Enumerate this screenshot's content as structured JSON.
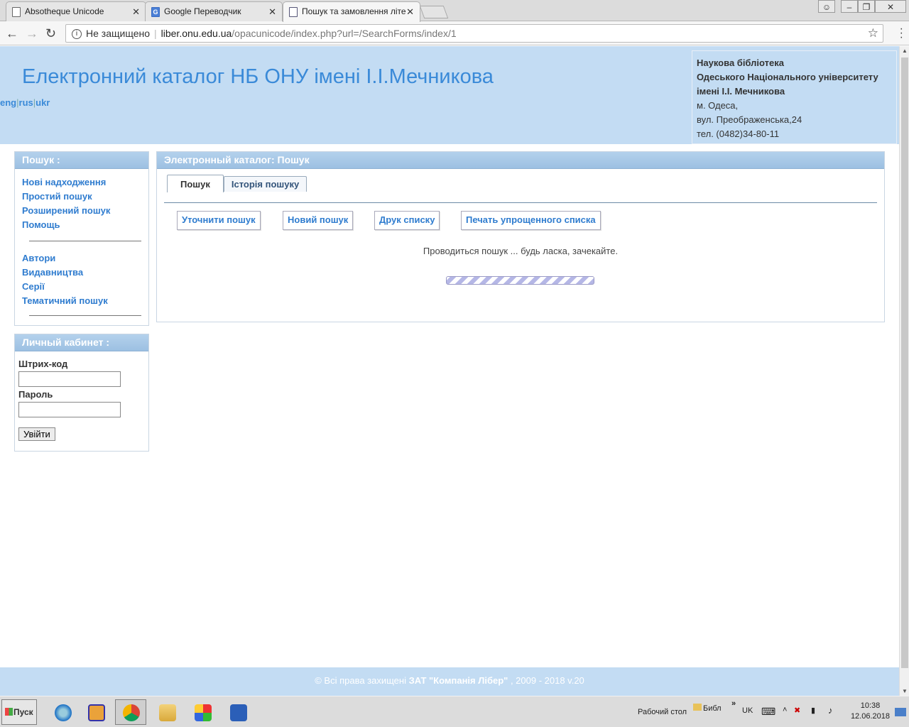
{
  "browser": {
    "tabs": [
      {
        "title": "Absotheque Unicode",
        "icon": "page-icon"
      },
      {
        "title": "Google Переводчик",
        "icon": "google-translate-icon"
      },
      {
        "title": "Пошук та замовлення літе",
        "icon": "library-icon"
      }
    ],
    "address": {
      "security": "Не защищено",
      "host": "liber.onu.edu.ua",
      "path": "/opacunicode/index.php?url=/SearchForms/index/1"
    }
  },
  "header": {
    "title": "Електронний каталог НБ ОНУ імені І.І.Мечникова",
    "langs": [
      "eng",
      "rus",
      "ukr"
    ],
    "contact": {
      "line1": "Наукова бібліотека",
      "line2": "Одеського Національного університету",
      "line3": "імені І.І. Мечникова",
      "line4": "м. Одеса,",
      "line5": "вул. Преображенська,24",
      "line6": "тел. (0482)34-80-11"
    }
  },
  "search_panel": {
    "title": "Пошук :",
    "links_a": [
      "Нові надходження",
      "Простий пошук",
      "Розширений пошук",
      "Помощь"
    ],
    "links_b": [
      "Автори",
      "Видавництва",
      "Серії",
      "Тематичний пошук"
    ]
  },
  "cabinet": {
    "title": "Личный кабинет :",
    "barcode_label": "Штрих-код",
    "password_label": "Пароль",
    "login_button": "Увійти"
  },
  "main": {
    "title": "Электронный каталог: Пошук",
    "tabs": [
      "Пошук",
      "Історія пошуку"
    ],
    "buttons": [
      "Уточнити пошук",
      "Новий пошук",
      "Друк списку",
      "Печать упрощенного списка"
    ],
    "wait_text": "Проводиться пошук ... будь ласка, зачекайте."
  },
  "footer": {
    "text_a": "© Всі права захищені ",
    "company": "ЗАТ \"Компанія Лібер\"",
    "text_b": " , 2009 - 2018  v.20"
  },
  "taskbar": {
    "start": "Пуск",
    "desktop": "Рабочий стол",
    "folder": "Библ",
    "lang": "UK",
    "time": "10:38",
    "date": "12.06.2018"
  },
  "colors": {
    "header_bg": "#c3dcf3",
    "link": "#2f7ccf",
    "title": "#3a8ad8"
  }
}
